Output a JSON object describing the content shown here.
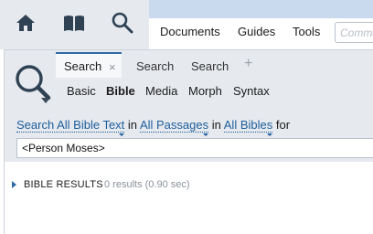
{
  "toolbar": {
    "icons": [
      "home-icon",
      "library-book-icon",
      "search-icon"
    ],
    "nav": [
      {
        "label": "Documents"
      },
      {
        "label": "Guides"
      },
      {
        "label": "Tools"
      }
    ],
    "command_placeholder": "Command"
  },
  "search_panel": {
    "logo_icon": "search-icon",
    "tabs": [
      {
        "label": "Search",
        "active": true
      },
      {
        "label": "Search"
      },
      {
        "label": "Search"
      }
    ],
    "tab_close": "×",
    "tab_add": "+",
    "subtabs": [
      {
        "label": "Basic"
      },
      {
        "label": "Bible",
        "active": true
      },
      {
        "label": "Media"
      },
      {
        "label": "Morph"
      },
      {
        "label": "Syntax"
      }
    ],
    "query": {
      "search": "Search",
      "scope": "All Bible Text",
      "in1": "in",
      "passages": "All Passages",
      "in2": "in",
      "bibles": "All Bibles",
      "for": "for"
    },
    "query_value": "<Person Moses>",
    "results": {
      "label": "BIBLE RESULTS",
      "count": "0 results (0.90 sec)"
    }
  },
  "colors": {
    "toolbar_bg": "#e6e9ee",
    "strip_bg": "#c9d9ee",
    "link_blue": "#1d5e9c",
    "active_tab_border": "#2f6aa8"
  }
}
